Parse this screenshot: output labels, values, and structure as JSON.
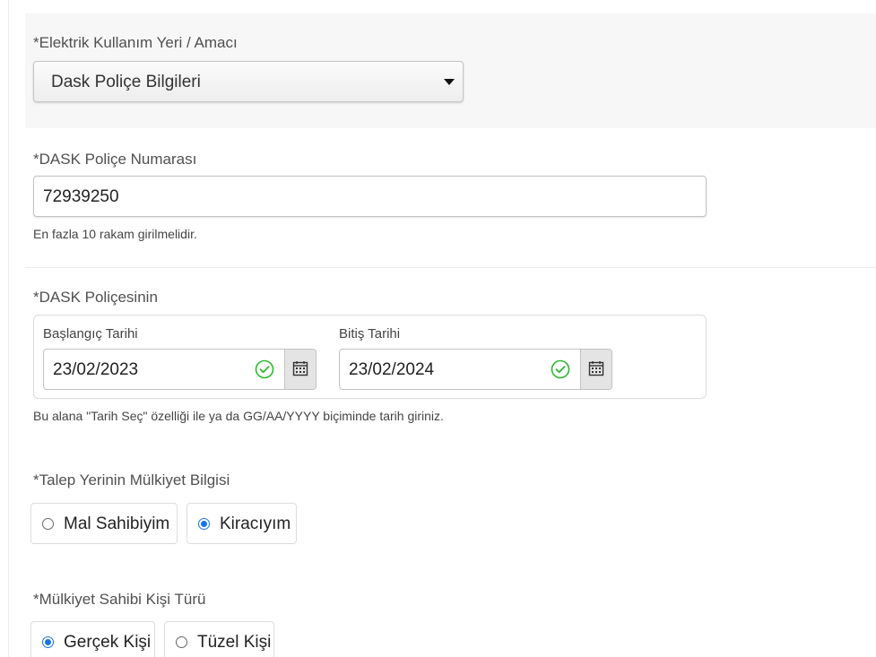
{
  "usage": {
    "label": "*Elektrik Kullanım Yeri / Amacı",
    "selected": "Dask Poliçe Bilgileri"
  },
  "policy_number": {
    "label": "*DASK Poliçe Numarası",
    "value": "72939250",
    "help": "En fazla 10 rakam girilmelidir."
  },
  "policy_dates": {
    "label": "*DASK Poliçesinin",
    "start": {
      "label": "Başlangıç Tarihi",
      "value": "23/02/2023"
    },
    "end": {
      "label": "Bitiş Tarihi",
      "value": "23/02/2024"
    },
    "help": "Bu alana \"Tarih Seç\" özelliği ile ya da GG/AA/YYYY biçiminde tarih giriniz."
  },
  "ownership": {
    "label": "*Talep Yerinin Mülkiyet Bilgisi",
    "options": [
      {
        "label": "Mal Sahibiyim",
        "selected": false
      },
      {
        "label": "Kiracıyım",
        "selected": true
      }
    ]
  },
  "owner_type": {
    "label": "*Mülkiyet Sahibi Kişi Türü",
    "options": [
      {
        "label": "Gerçek Kişi",
        "selected": true
      },
      {
        "label": "Tüzel Kişi",
        "selected": false
      }
    ]
  },
  "icons": {
    "dropdown": "caret-down-icon",
    "valid": "check-circle-icon",
    "calendar": "calendar-icon"
  },
  "colors": {
    "valid_green": "#2eb82e",
    "radio_blue": "#1a73e8",
    "section_bg": "#f7f7f7"
  }
}
